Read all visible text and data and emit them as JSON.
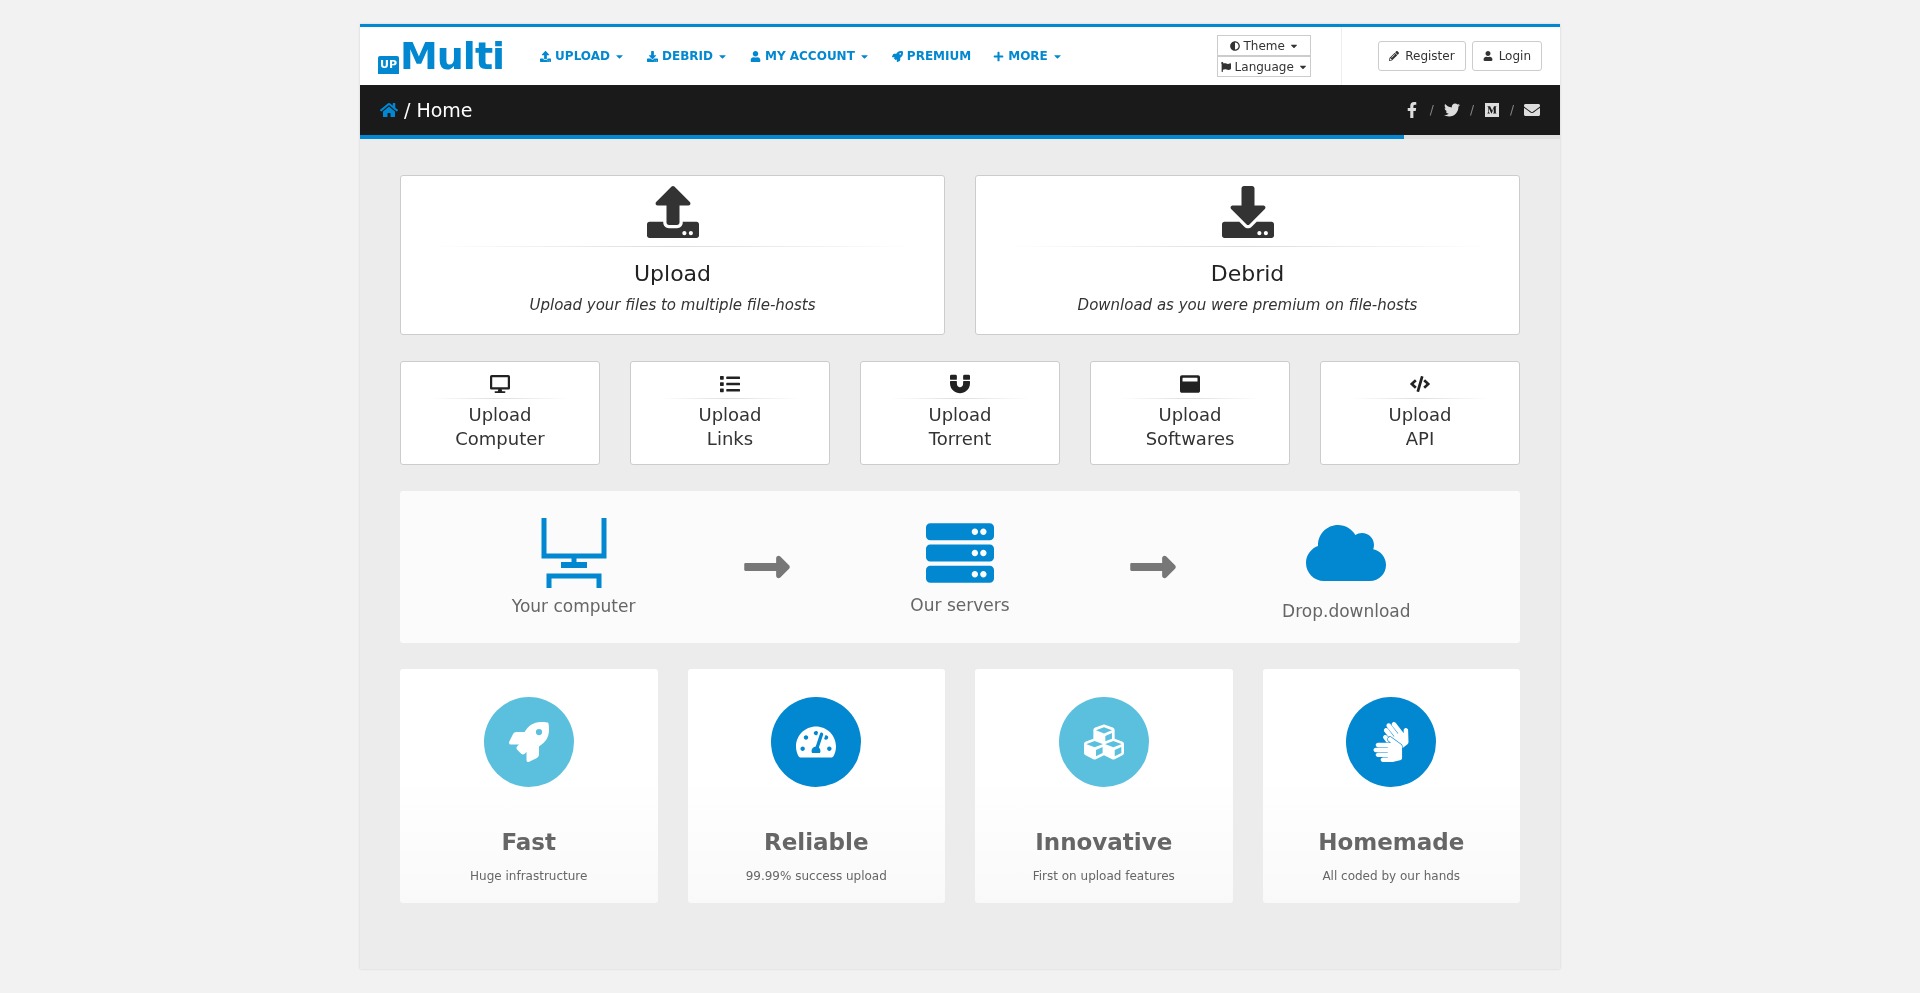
{
  "logo": {
    "badge": "UP",
    "name": "Multi"
  },
  "nav": [
    {
      "label": "UPLOAD",
      "kind": "upload",
      "dropdown": true
    },
    {
      "label": "DEBRID",
      "kind": "download",
      "dropdown": true
    },
    {
      "label": "MY ACCOUNT",
      "kind": "user",
      "dropdown": true
    },
    {
      "label": "PREMIUM",
      "kind": "rocket",
      "dropdown": false
    },
    {
      "label": "MORE",
      "kind": "plus",
      "dropdown": true
    }
  ],
  "selectors": [
    {
      "label": "Theme",
      "kind": "theme"
    },
    {
      "label": "Language",
      "kind": "flag"
    }
  ],
  "auth_buttons": [
    {
      "label": "Register",
      "kind": "pencil"
    },
    {
      "label": "Login",
      "kind": "user"
    }
  ],
  "breadcrumb": {
    "separator": "/",
    "current": "Home"
  },
  "social": [
    {
      "kind": "facebook"
    },
    {
      "kind": "twitter"
    },
    {
      "kind": "medium"
    },
    {
      "kind": "mail"
    }
  ],
  "social_separator": "/",
  "loading_bar": {
    "level": 0.87
  },
  "main_cards": [
    {
      "kind": "upload",
      "title": "Upload",
      "subtitle": "Upload your files to multiple file-hosts"
    },
    {
      "kind": "download",
      "title": "Debrid",
      "subtitle": "Download as you were premium on file-hosts"
    }
  ],
  "upload_options": [
    {
      "kind": "desktop",
      "line1": "Upload",
      "line2": "Computer"
    },
    {
      "kind": "list",
      "line1": "Upload",
      "line2": "Links"
    },
    {
      "kind": "magnet",
      "line1": "Upload",
      "line2": "Torrent"
    },
    {
      "kind": "window",
      "line1": "Upload",
      "line2": "Softwares"
    },
    {
      "kind": "code",
      "line1": "Upload",
      "line2": "API"
    }
  ],
  "flow": [
    {
      "kind": "computer",
      "caption": "Your computer"
    },
    {
      "kind": "servers",
      "caption": "Our servers"
    },
    {
      "kind": "cloud",
      "caption": "Drop.download"
    }
  ],
  "features": [
    {
      "kind": "rocket",
      "color": "#5bc0de",
      "title": "Fast",
      "text": "Huge infrastructure"
    },
    {
      "kind": "gauge",
      "color": "#0288d1",
      "title": "Reliable",
      "text": "99.99% success upload"
    },
    {
      "kind": "cubes",
      "color": "#5bc0de",
      "title": "Innovative",
      "text": "First on upload features"
    },
    {
      "kind": "hands",
      "color": "#0288d1",
      "title": "Homemade",
      "text": "All coded by our hands"
    }
  ]
}
